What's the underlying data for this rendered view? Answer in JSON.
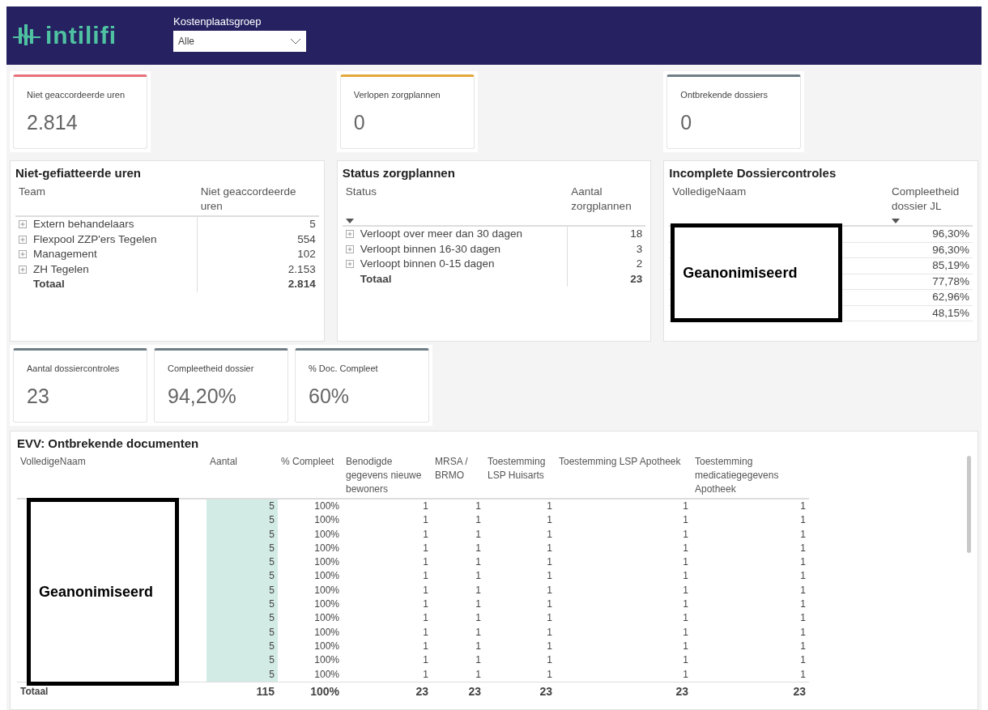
{
  "header": {
    "logo": "intilifi",
    "filter": {
      "label": "Kostenplaatsgroep",
      "value": "Alle"
    }
  },
  "top_cards": [
    {
      "title": "Niet geaccordeerde uren",
      "value": "2.814",
      "color": "#e8707a"
    },
    {
      "title": "Verlopen zorgplannen",
      "value": "0",
      "color": "#e3a83a"
    },
    {
      "title": "Ontbrekende dossiers",
      "value": "0",
      "color": "#6f7d86"
    }
  ],
  "panels": [
    {
      "title": "Niet-gefiatteerde uren",
      "columns": [
        {
          "label": "Team"
        },
        {
          "label": "Niet geaccordeerde uren"
        }
      ],
      "rows": [
        {
          "cells": [
            "Extern behandelaars",
            "5"
          ]
        },
        {
          "cells": [
            "Flexpool ZZP'ers Tegelen",
            "554"
          ]
        },
        {
          "cells": [
            "Management",
            "102"
          ]
        },
        {
          "cells": [
            "ZH Tegelen",
            "2.153"
          ]
        }
      ],
      "total": [
        "Totaal",
        "2.814"
      ]
    },
    {
      "title": "Status zorgplannen",
      "columns": [
        {
          "label": "Status",
          "sorted": true
        },
        {
          "label": "Aantal zorgplannen"
        }
      ],
      "rows": [
        {
          "cells": [
            "Verloopt over meer dan 30 dagen",
            "18"
          ]
        },
        {
          "cells": [
            "Verloopt binnen 16-30 dagen",
            "3"
          ]
        },
        {
          "cells": [
            "Verloopt binnen 0-15 dagen",
            "2"
          ]
        }
      ],
      "total": [
        "Totaal",
        "23"
      ]
    },
    {
      "title": "Incomplete Dossiercontroles",
      "columns": [
        {
          "label": "VolledigeNaam"
        },
        {
          "label": "Compleetheid dossier JL",
          "sorted": true
        }
      ],
      "rows": [
        {
          "cells": [
            "",
            "96,30%"
          ]
        },
        {
          "cells": [
            "",
            "96,30%"
          ]
        },
        {
          "cells": [
            "",
            "85,19%"
          ]
        },
        {
          "cells": [
            "",
            "77,78%"
          ]
        },
        {
          "cells": [
            "",
            "62,96%"
          ]
        },
        {
          "cells": [
            "",
            "48,15%"
          ]
        }
      ],
      "redaction": "Geanonimiseerd"
    }
  ],
  "mid_cards": [
    {
      "title": "Aantal dossiercontroles",
      "value": "23",
      "color": "#6f7d86"
    },
    {
      "title": "Compleetheid dossier",
      "value": "94,20%",
      "color": "#6f7d86"
    },
    {
      "title": "% Doc. Compleet",
      "value": "60%",
      "color": "#6f7d86"
    }
  ],
  "evv": {
    "title": "EVV: Ontbrekende documenten",
    "redaction": "Geanonimiseerd",
    "columns": [
      "VolledigeNaam",
      "Aantal",
      "% Compleet",
      "Benodigde gegevens nieuwe bewoners",
      "MRSA / BRMO",
      "Toestemming LSP Huisarts",
      "Toestemming LSP Apotheek",
      "Toestemming medicatiegegevens Apotheek"
    ],
    "rows": [
      [
        "",
        "5",
        "100%",
        "1",
        "1",
        "1",
        "1",
        "1"
      ],
      [
        "",
        "5",
        "100%",
        "1",
        "1",
        "1",
        "1",
        "1"
      ],
      [
        "",
        "5",
        "100%",
        "1",
        "1",
        "1",
        "1",
        "1"
      ],
      [
        "",
        "5",
        "100%",
        "1",
        "1",
        "1",
        "1",
        "1"
      ],
      [
        "",
        "5",
        "100%",
        "1",
        "1",
        "1",
        "1",
        "1"
      ],
      [
        "",
        "5",
        "100%",
        "1",
        "1",
        "1",
        "1",
        "1"
      ],
      [
        "",
        "5",
        "100%",
        "1",
        "1",
        "1",
        "1",
        "1"
      ],
      [
        "",
        "5",
        "100%",
        "1",
        "1",
        "1",
        "1",
        "1"
      ],
      [
        "",
        "5",
        "100%",
        "1",
        "1",
        "1",
        "1",
        "1"
      ],
      [
        "",
        "5",
        "100%",
        "1",
        "1",
        "1",
        "1",
        "1"
      ],
      [
        "",
        "5",
        "100%",
        "1",
        "1",
        "1",
        "1",
        "1"
      ],
      [
        "",
        "5",
        "100%",
        "1",
        "1",
        "1",
        "1",
        "1"
      ],
      [
        "",
        "5",
        "100%",
        "1",
        "1",
        "1",
        "1",
        "1"
      ]
    ],
    "total": [
      "Totaal",
      "115",
      "100%",
      "23",
      "23",
      "23",
      "23",
      "23"
    ]
  }
}
